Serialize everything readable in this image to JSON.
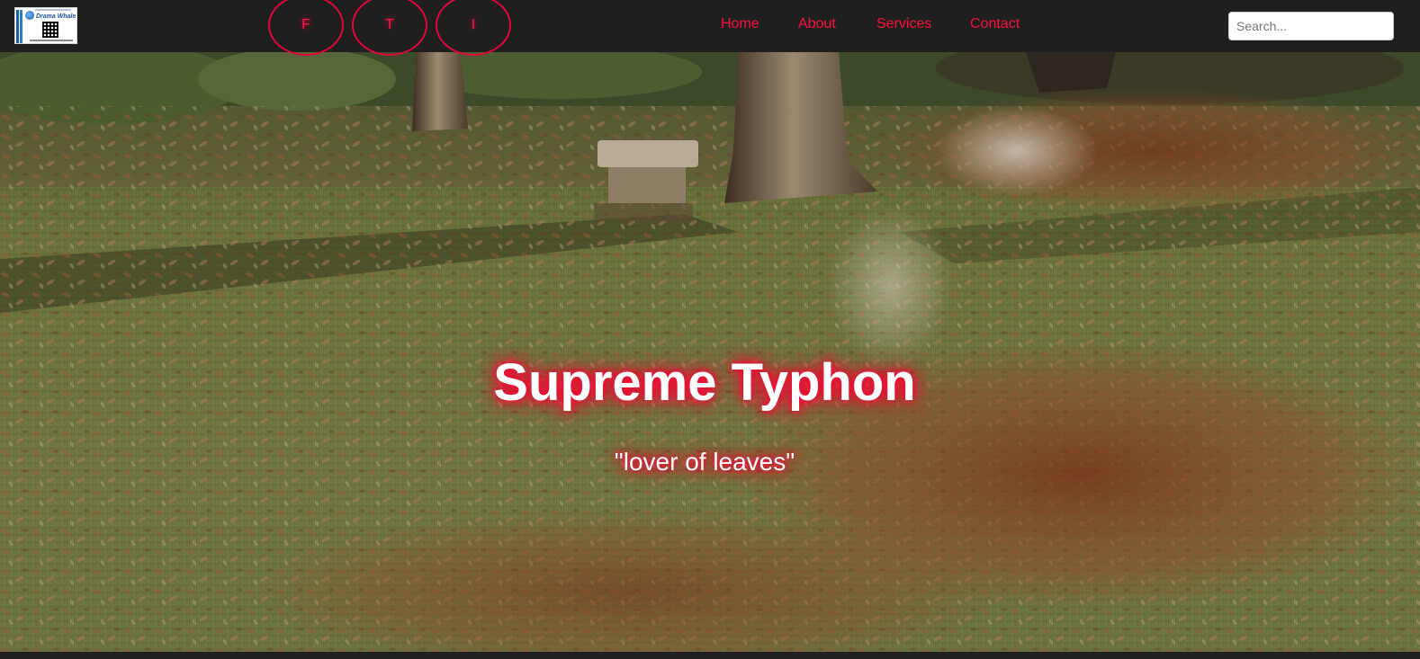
{
  "header": {
    "logo": {
      "brand_text": "Drama Whale",
      "accent_color": "#1f4f9a"
    },
    "social_buttons": [
      {
        "label": "F",
        "icon": "facebook-icon"
      },
      {
        "label": "T",
        "icon": "twitter-icon"
      },
      {
        "label": "I",
        "icon": "instagram-icon"
      }
    ],
    "nav": [
      {
        "label": "Home"
      },
      {
        "label": "About"
      },
      {
        "label": "Services"
      },
      {
        "label": "Contact"
      }
    ],
    "search": {
      "placeholder": "Search...",
      "value": ""
    }
  },
  "hero": {
    "title": "Supreme Typhon",
    "subtitle": "\"lover of leaves\""
  },
  "colors": {
    "navbar_bg": "#1f1f1f",
    "accent": "#ff0f3c",
    "glow": "#ff0033"
  }
}
